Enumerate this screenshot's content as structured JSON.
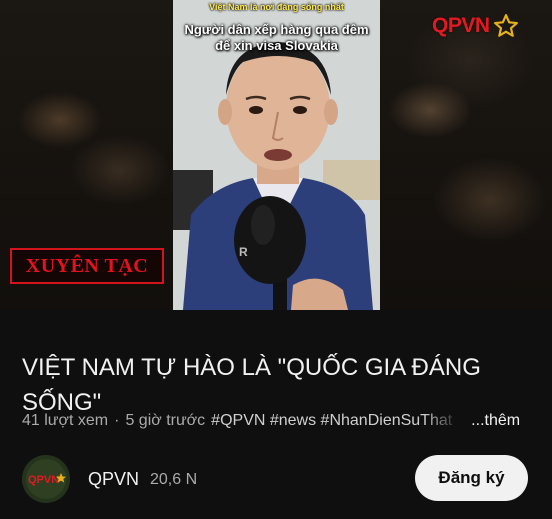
{
  "video": {
    "caption_top": "Việt Nam là nơi đáng sống nhất",
    "caption_main": "Người dân xếp hàng qua đêm để xin visa Slovakia",
    "stamp_label": "XUYÊN TẠC",
    "logo_text": "QPVN",
    "logo_icon": "star-icon"
  },
  "title": "VIỆT NAM TỰ HÀO LÀ \"QUỐC GIA ĐÁNG SỐNG\"",
  "meta": {
    "views": "41 lượt xem",
    "separator": "·",
    "time": "5 giờ trước",
    "hashtags": "#QPVN #news #NhanDienSuThat",
    "more": "...thêm"
  },
  "channel": {
    "name": "QPVN",
    "subscribers": "20,6 N",
    "avatar_text": "QPVN",
    "subscribe_label": "Đăng ký"
  },
  "colors": {
    "background": "#0f0f0f",
    "brand_red": "#e11a22",
    "caption_yellow": "#ffe94a",
    "subscribe_bg": "#f1f1f1"
  }
}
